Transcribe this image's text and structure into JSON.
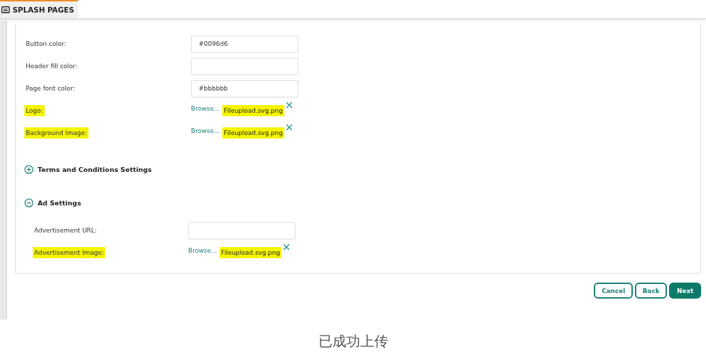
{
  "header": {
    "tab": {
      "label": "SPLASH PAGES",
      "selected": true
    }
  },
  "fields": [
    {
      "kind": "text",
      "label": "Button color:",
      "value": "#0096d6",
      "highlighted": false
    },
    {
      "kind": "text",
      "label": "Header fill color:",
      "highlighted": false
    },
    {
      "kind": "text",
      "label": "Page font color:",
      "value": "#bbbbbb",
      "highlighted": false
    },
    {
      "kind": "file",
      "label": "Logo:",
      "browse": "Browse...",
      "file": "Fileupload.svg.png",
      "highlighted": true
    },
    {
      "kind": "file",
      "label": "Background Image:",
      "browse": "Browse...",
      "file": "Fileupload.svg.png",
      "highlighted": true
    }
  ],
  "sections": [
    {
      "title": "Terms and Conditions Settings",
      "expanded": false
    },
    {
      "title": "Ad Settings",
      "expanded": true,
      "fields": [
        {
          "kind": "text",
          "label": "Advertisement URL:",
          "highlighted": false
        },
        {
          "kind": "file",
          "label": "Advertisement Image:",
          "browse": "Browse...",
          "file": "Fileupload.svg.png",
          "highlighted": true
        }
      ]
    }
  ],
  "buttons": [
    {
      "label": "Cancel",
      "kind": "secondary"
    },
    {
      "label": "Back",
      "kind": "secondary"
    },
    {
      "label": "Next",
      "kind": "primary"
    }
  ],
  "caption": "已成功上传"
}
